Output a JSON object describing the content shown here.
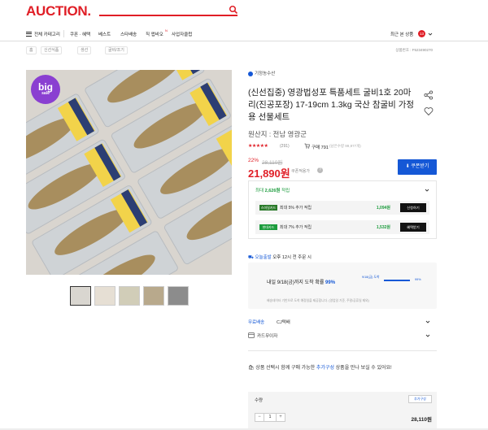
{
  "header": {
    "logo": "AUCTION.",
    "search_placeholder": ""
  },
  "nav": {
    "category": "전체 카테고리",
    "items": [
      "쿠폰 · 혜택",
      "베스트",
      "스타배송",
      "직 앱비오",
      "사업자클럽"
    ],
    "new_badge": "N",
    "recent": "최근 본 상품",
    "recent_count": "13"
  },
  "breadcrumb": {
    "items": [
      "홈",
      "신선식품",
      "생선",
      "굴비/조기"
    ],
    "product_code": "상품번호 : F523490270"
  },
  "image": {
    "badge_main": "big",
    "badge_sub": "sale"
  },
  "product": {
    "seller": "기정농수산",
    "title": "(신선집중) 영광법성포 특품세트 굴비1호 20마리(진공포장) 17-19cm 1.3kg 국산 참굴비 가정용 선물세트",
    "origin": "원산지 : 전남 영광군",
    "stars": "★★★★★",
    "reviews": "(291)",
    "buy_count": "구매 791",
    "buy_sub": "(남은수량 99,977개)",
    "discount": "22%",
    "original_price": "28,110원",
    "price": "21,890원",
    "coupon_label": "쿠폰적용가",
    "coupon_button": "쿠폰받기"
  },
  "points": {
    "title_prefix": "최대",
    "title_amount": "2,626원",
    "title_suffix": "적립",
    "rows": [
      {
        "card": "스마일카드",
        "text": "최대 5% 추가 적립",
        "amount": "1,094원",
        "button": "신청하기"
      },
      {
        "card": "현대카드",
        "text": "최대 7% 추가 적립",
        "amount": "1,532원",
        "button": "혜택받기"
      }
    ]
  },
  "delivery": {
    "tag": "오늘출발",
    "text": "오후 12시 전 주문 시",
    "arrive_prefix": "내일 9/18(금)까지 도착 확률",
    "arrive_pct": "99%",
    "bar_start": "9/18(금) 도착",
    "bar_end": "99%",
    "bar_fill": 0.99,
    "note": "배송데이터 기반으로 도착 예정일을 제공합니다. (영업일 기준, 주말/공휴일 제외)"
  },
  "options": {
    "shipping_label": "무료배송",
    "shipping_value": "CJ택배",
    "card_label": "카드무이자",
    "notice_prefix": "상품 선택시 함께 구매 가능한",
    "notice_highlight": "추가구성",
    "notice_suffix": "상품을 만나 보실 수 있어요!"
  },
  "quantity": {
    "label": "수량",
    "add_option": "추가구성",
    "value": "1",
    "minus": "−",
    "plus": "+",
    "total": "28,110원"
  }
}
